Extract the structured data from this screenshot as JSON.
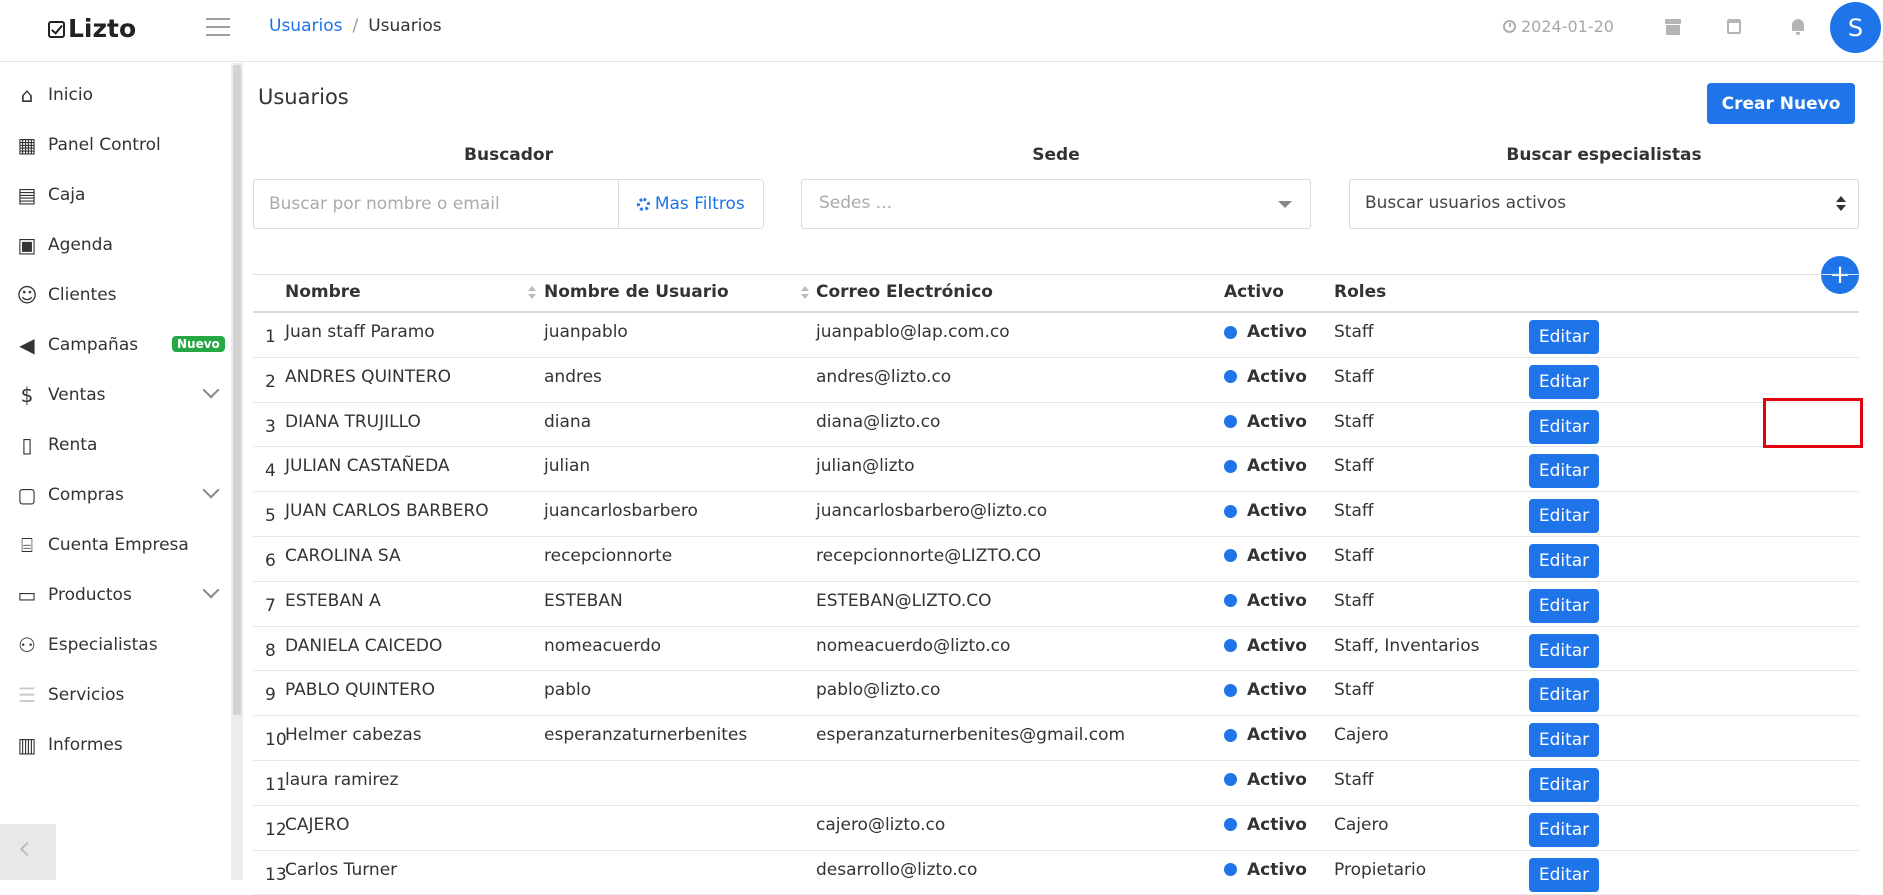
{
  "app": {
    "logo": "Lizto"
  },
  "breadcrumb": {
    "parent": "Usuarios",
    "separator": "/",
    "current": "Usuarios"
  },
  "topbar": {
    "date": "2024-01-20",
    "avatar_letter": "S"
  },
  "sidebar": {
    "items": [
      {
        "label": "Inicio",
        "icon": "home-icon"
      },
      {
        "label": "Panel Control",
        "icon": "dashboard-icon"
      },
      {
        "label": "Caja",
        "icon": "cash-register-icon"
      },
      {
        "label": "Agenda",
        "icon": "calendar-icon"
      },
      {
        "label": "Clientes",
        "icon": "smiley-icon"
      },
      {
        "label": "Campañas",
        "icon": "megaphone-icon",
        "badge": "Nuevo"
      },
      {
        "label": "Ventas",
        "icon": "dollar-icon",
        "expandable": true
      },
      {
        "label": "Renta",
        "icon": "invoice-icon"
      },
      {
        "label": "Compras",
        "icon": "shopping-bag-icon",
        "expandable": true
      },
      {
        "label": "Cuenta Empresa",
        "icon": "bank-icon"
      },
      {
        "label": "Productos",
        "icon": "archive-icon",
        "expandable": true
      },
      {
        "label": "Especialistas",
        "icon": "users-icon"
      },
      {
        "label": "Servicios",
        "icon": "list-icon"
      },
      {
        "label": "Informes",
        "icon": "bar-chart-icon"
      }
    ]
  },
  "page": {
    "title": "Usuarios",
    "create_label": "Crear Nuevo"
  },
  "filters": {
    "search_label": "Buscador",
    "search_placeholder": "Buscar por nombre o email",
    "more_filters": "Mas Filtros",
    "sede_label": "Sede",
    "sede_value": "Sedes ...",
    "especialistas_label": "Buscar especialistas",
    "especialistas_value": "Buscar usuarios activos"
  },
  "table": {
    "headers": {
      "name": "Nombre",
      "username": "Nombre de Usuario",
      "email": "Correo Electrónico",
      "active": "Activo",
      "roles": "Roles"
    },
    "edit_label": "Editar",
    "rows": [
      {
        "n": "1",
        "name": "Juan staff Paramo",
        "username": "juanpablo",
        "email": "juanpablo@lap.com.co",
        "active": "Activo",
        "roles": "Staff"
      },
      {
        "n": "2",
        "name": "ANDRES QUINTERO",
        "username": "andres",
        "email": "andres@lizto.co",
        "active": "Activo",
        "roles": "Staff"
      },
      {
        "n": "3",
        "name": "DIANA TRUJILLO",
        "username": "diana",
        "email": "diana@lizto.co",
        "active": "Activo",
        "roles": "Staff"
      },
      {
        "n": "4",
        "name": "JULIAN CASTAÑEDA",
        "username": "julian",
        "email": "julian@lizto",
        "active": "Activo",
        "roles": "Staff"
      },
      {
        "n": "5",
        "name": "JUAN CARLOS BARBERO",
        "username": "juancarlosbarbero",
        "email": "juancarlosbarbero@lizto.co",
        "active": "Activo",
        "roles": "Staff"
      },
      {
        "n": "6",
        "name": "CAROLINA SA",
        "username": "recepcionnorte",
        "email": "recepcionnorte@LIZTO.CO",
        "active": "Activo",
        "roles": "Staff"
      },
      {
        "n": "7",
        "name": "ESTEBAN A",
        "username": "ESTEBAN",
        "email": "ESTEBAN@LIZTO.CO",
        "active": "Activo",
        "roles": "Staff"
      },
      {
        "n": "8",
        "name": "DANIELA CAICEDO",
        "username": "nomeacuerdo",
        "email": "nomeacuerdo@lizto.co",
        "active": "Activo",
        "roles": "Staff, Inventarios"
      },
      {
        "n": "9",
        "name": "PABLO QUINTERO",
        "username": "pablo",
        "email": "pablo@lizto.co",
        "active": "Activo",
        "roles": "Staff"
      },
      {
        "n": "10",
        "name": "Helmer cabezas",
        "username": "esperanzaturnerbenites",
        "email": "esperanzaturnerbenites@gmail.com",
        "active": "Activo",
        "roles": "Cajero"
      },
      {
        "n": "11",
        "name": "laura ramirez",
        "username": "",
        "email": "",
        "active": "Activo",
        "roles": "Staff"
      },
      {
        "n": "12",
        "name": "CAJERO",
        "username": "",
        "email": "cajero@lizto.co",
        "active": "Activo",
        "roles": "Cajero"
      },
      {
        "n": "13",
        "name": "Carlos Turner",
        "username": "",
        "email": "desarrollo@lizto.co",
        "active": "Activo",
        "roles": "Propietario"
      }
    ]
  },
  "colors": {
    "accent": "#1e74e8",
    "badge": "#27a844",
    "highlight": "#e3000f"
  }
}
